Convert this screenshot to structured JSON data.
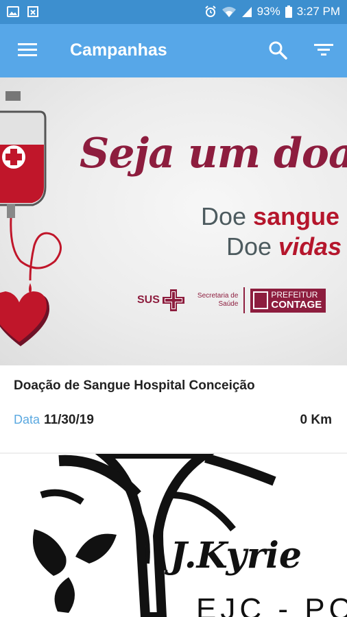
{
  "status_bar": {
    "battery": "93%",
    "time": "3:27 PM",
    "icons": [
      "image-icon",
      "download-icon",
      "alarm-icon",
      "wifi-icon",
      "signal-icon",
      "battery-icon"
    ]
  },
  "app_bar": {
    "title": "Campanhas",
    "color": "#57a7e8",
    "icons": [
      "menu-icon",
      "search-icon",
      "filter-icon"
    ]
  },
  "campaigns": [
    {
      "banner": {
        "slogan": "Seja um doado",
        "line1_a": "Doe ",
        "line1_b": "sangue",
        "line2_a": "Doe ",
        "line2_b": "vidas",
        "sus": "SUS",
        "secretaria_1": "Secretaria de",
        "secretaria_2": "Saúde",
        "prefeitura_1": "PREFEITUR",
        "prefeitura_2": "CONTAGE"
      },
      "title": "Doação de Sangue Hospital Conceição",
      "date_label": "Data",
      "date": "11/30/19",
      "distance": "0 Km"
    },
    {
      "banner": {
        "brand": "J.Kyrie",
        "sub": "EJC - POA"
      }
    }
  ]
}
